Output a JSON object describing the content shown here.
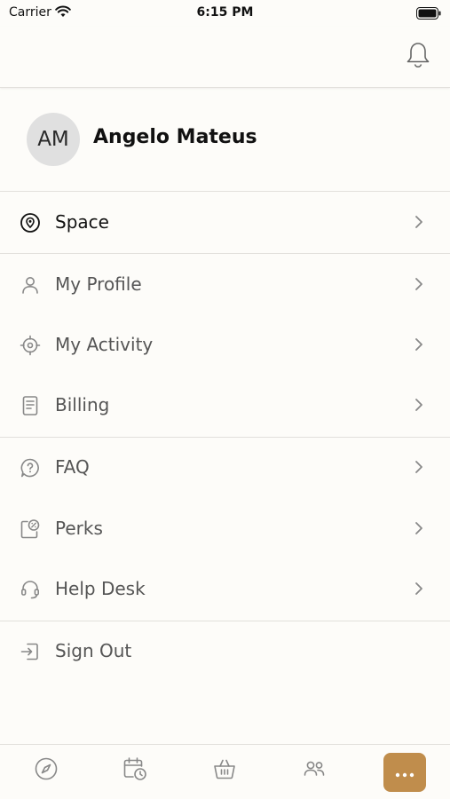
{
  "status_bar": {
    "carrier": "Carrier",
    "time": "6:15 PM"
  },
  "profile": {
    "initials": "AM",
    "name": "Angelo Mateus"
  },
  "menu": {
    "space": "Space",
    "my_profile": "My Profile",
    "my_activity": "My Activity",
    "billing": "Billing",
    "faq": "FAQ",
    "perks": "Perks",
    "help_desk": "Help Desk",
    "sign_out": "Sign Out"
  },
  "tabbar": {
    "more_icon": "more-dots-icon",
    "active_color": "#c08d4c"
  },
  "icons": [
    "wifi-icon",
    "battery-icon",
    "bell-icon",
    "location-pin-icon",
    "user-icon",
    "crosshair-icon",
    "receipt-icon",
    "question-bubble-icon",
    "coupon-icon",
    "headset-icon",
    "sign-out-icon",
    "compass-icon",
    "calendar-clock-icon",
    "basket-icon",
    "people-icon"
  ]
}
